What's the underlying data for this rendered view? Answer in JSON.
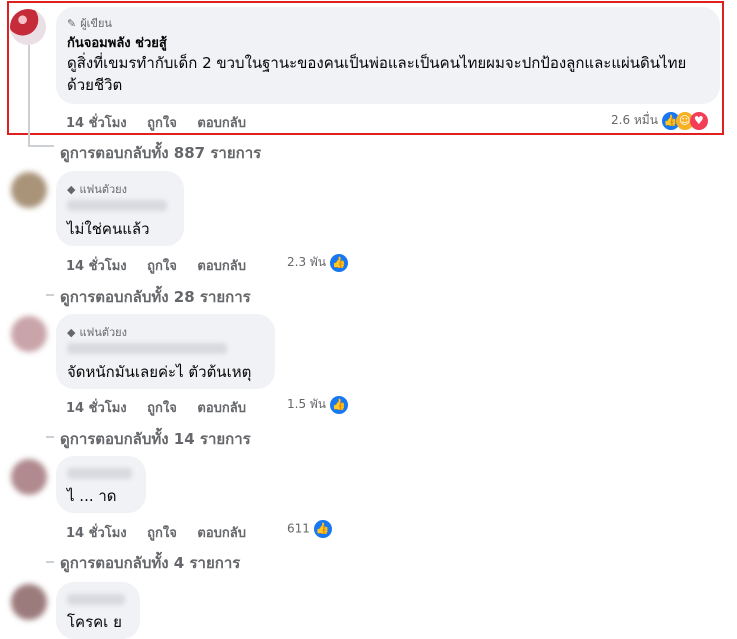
{
  "top_comment": {
    "badge": "ผู้เขียน",
    "author": "กันจอมพลัง ช่วยสู้",
    "text": "ดูสิ่งที่เขมรทำกับเด็ก 2 ขวบในฐานะของคนเป็นพ่อและเป็นคนไทยผมจะปกป้องลูกและแผ่นดินไทยด้วยชีวิต",
    "time": "14 ชั่วโมง",
    "like": "ถูกใจ",
    "reply": "ตอบกลับ",
    "reaction_count": "2.6 หมื่น"
  },
  "view_replies_top": "ดูการตอบกลับทั้ง 887 รายการ",
  "comments": [
    {
      "badge": "แฟนตัวยง",
      "text": "ไม่ใช่คนแล้ว",
      "time": "14 ชั่วโมง",
      "like": "ถูกใจ",
      "reply": "ตอบกลับ",
      "reaction_count": "2.3 พัน",
      "view_replies": "ดูการตอบกลับทั้ง 28 รายการ"
    },
    {
      "badge": "แฟนตัวยง",
      "text": "จัดหนักมันเลยค่ะไ  ตัวต้นเหตุ",
      "time": "14 ชั่วโมง",
      "like": "ถูกใจ",
      "reply": "ตอบกลับ",
      "reaction_count": "1.5 พัน",
      "view_replies": "ดูการตอบกลับทั้ง 14 รายการ"
    },
    {
      "text": "ไ  ...  าด",
      "time": "14 ชั่วโมง",
      "like": "ถูกใจ",
      "reply": "ตอบกลับ",
      "reaction_count": "611",
      "view_replies": "ดูการตอบกลับทั้ง 4 รายการ"
    },
    {
      "text": "โครคเ  ย"
    }
  ],
  "icons": {
    "pencil": "pencil-icon",
    "diamond": "diamond-icon",
    "like": "like-reaction-icon",
    "care": "care-reaction-icon",
    "love": "love-reaction-icon"
  },
  "colors": {
    "highlight": "#e02020",
    "bubble": "#f0f2f5",
    "like_blue": "#1877f2",
    "muted": "#65676b"
  }
}
